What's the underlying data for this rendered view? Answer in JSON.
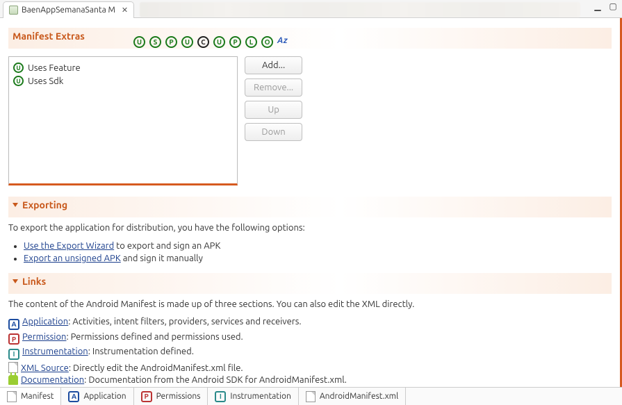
{
  "tab": {
    "title": "BaenAppSemanaSanta M"
  },
  "manifest_extras": {
    "title": "Manifest Extras",
    "toolbar": [
      "U",
      "S",
      "P",
      "U",
      "C",
      "U",
      "P",
      "L",
      "O"
    ],
    "az_label": "Az",
    "items": [
      "Uses Feature",
      "Uses Sdk"
    ],
    "buttons": {
      "add": "Add...",
      "remove": "Remove...",
      "up": "Up",
      "down": "Down"
    }
  },
  "exporting": {
    "title": "Exporting",
    "intro": "To export the application for distribution, you have the following options:",
    "opt1_link": "Use the Export Wizard",
    "opt1_rest": " to export and sign an APK",
    "opt2_link": "Export an unsigned APK",
    "opt2_rest": " and sign it manually"
  },
  "links": {
    "title": "Links",
    "intro": "The content of the Android Manifest is made up of three sections. You can also edit the XML directly.",
    "items": [
      {
        "icon": "A",
        "iconClass": "sq-blue",
        "label": "Application",
        "desc": ": Activities, intent filters, providers, services and receivers."
      },
      {
        "icon": "P",
        "iconClass": "sq-red",
        "label": "Permission",
        "desc": ": Permissions defined and permissions used."
      },
      {
        "icon": "I",
        "iconClass": "sq-teal",
        "label": "Instrumentation",
        "desc": ": Instrumentation defined."
      },
      {
        "icon": "xml",
        "iconClass": "xmlfile",
        "label": "XML Source",
        "desc": ": Directly edit the AndroidManifest.xml file."
      },
      {
        "icon": "android",
        "iconClass": "android",
        "label": "Documentation",
        "desc": ": Documentation from the Android SDK for AndroidManifest.xml."
      }
    ]
  },
  "bottom_tabs": [
    "Manifest",
    "Application",
    "Permissions",
    "Instrumentation",
    "AndroidManifest.xml"
  ]
}
